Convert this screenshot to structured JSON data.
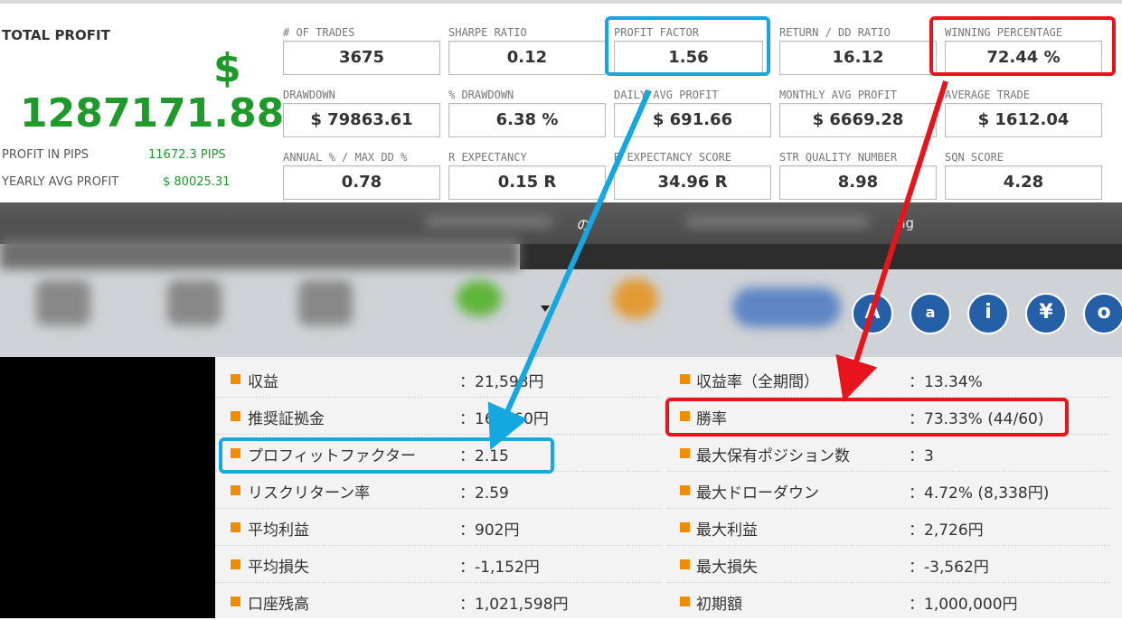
{
  "stats_panel": {
    "total_profit_label": "TOTAL PROFIT",
    "currency_symbol": "$",
    "total_profit_value": "1287171.88",
    "profit_in_pips_label": "PROFIT IN PIPS",
    "profit_in_pips_value": "11672.3 PIPS",
    "yearly_avg_profit_label": "YEARLY AVG PROFIT",
    "yearly_avg_profit_value": "$ 80025.31",
    "metrics": [
      {
        "label": "# OF TRADES",
        "value": "3675"
      },
      {
        "label": "SHARPE RATIO",
        "value": "0.12"
      },
      {
        "label": "PROFIT FACTOR",
        "value": "1.56"
      },
      {
        "label": "RETURN / DD RATIO",
        "value": "16.12"
      },
      {
        "label": "WINNING PERCENTAGE",
        "value": "72.44 %"
      },
      {
        "label": "DRAWDOWN",
        "value": "$ 79863.61"
      },
      {
        "label": "% DRAWDOWN",
        "value": "6.38 %"
      },
      {
        "label": "DAILY AVG PROFIT",
        "value": "$ 691.66"
      },
      {
        "label": "MONTHLY AVG PROFIT",
        "value": "$ 6669.28"
      },
      {
        "label": "AVERAGE TRADE",
        "value": "$ 1612.04"
      },
      {
        "label": "ANNUAL % / MAX DD %",
        "value": "0.78"
      },
      {
        "label": "R EXPECTANCY",
        "value": "0.15 R"
      },
      {
        "label": "R EXPECTANCY SCORE",
        "value": "34.96 R"
      },
      {
        "label": "STR QUALITY NUMBER",
        "value": "8.98"
      },
      {
        "label": "SQN SCORE",
        "value": "4.28"
      }
    ]
  },
  "band": {
    "text_left": "の",
    "text_right": "ng"
  },
  "toolbar": {
    "icons": [
      "A",
      "a",
      "i",
      "¥",
      "o"
    ]
  },
  "jp_stats": {
    "left": [
      {
        "label": "収益",
        "value": "：21,598円"
      },
      {
        "label": "推奨証拠金",
        "value": "：16 ,960円"
      },
      {
        "label": "プロフィットファクター",
        "value": "：2.15"
      },
      {
        "label": "リスクリターン率",
        "value": "：2.59"
      },
      {
        "label": "平均利益",
        "value": "：902円"
      },
      {
        "label": "平均損失",
        "value": "：-1,152円"
      },
      {
        "label": "口座残高",
        "value": "：1,021,598円"
      }
    ],
    "right": [
      {
        "label": "収益率（全期間）",
        "value": "：13.34%"
      },
      {
        "label": "勝率",
        "value": "：73.33% (44/60)"
      },
      {
        "label": "最大保有ポジション数",
        "value": "：3"
      },
      {
        "label": "最大ドローダウン",
        "value": "：4.72% (8,338円)"
      },
      {
        "label": "最大利益",
        "value": "：2,726円"
      },
      {
        "label": "最大損失",
        "value": "：-3,562円"
      },
      {
        "label": "初期額",
        "value": "：1,000,000円"
      }
    ]
  },
  "colors": {
    "profit_green": "#1e9a2b",
    "highlight_blue": "#15a7e0",
    "highlight_red": "#e8141b",
    "bullet_orange": "#f08c00",
    "toolbar_icon_blue": "#245fa8"
  }
}
